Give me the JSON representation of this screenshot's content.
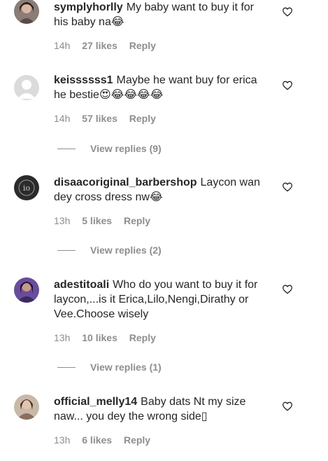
{
  "comments": [
    {
      "username": "symplyhorlly",
      "text": "My baby want to buy it for his baby na😂",
      "time": "14h",
      "likes": "27 likes",
      "reply": "Reply",
      "avatar": "photo-avatar-woman"
    },
    {
      "username": "keissssss1",
      "text": "Maybe he want buy for erica he bestie😍😂😂😂😂",
      "time": "14h",
      "likes": "57 likes",
      "reply": "Reply",
      "avatar": "default-avatar",
      "view_replies": "View replies (9)"
    },
    {
      "username": "disaacoriginal_barbershop",
      "text": "Laycon wan dey cross dress nw😂",
      "time": "13h",
      "likes": "5 likes",
      "reply": "Reply",
      "avatar": "logo-avatar-dark",
      "view_replies": "View replies (2)"
    },
    {
      "username": "adestitoali",
      "text": "Who do you want to buy it for laycon,...is it Erica,Lilo,Nengi,Dirathy or Vee.Choose wisely",
      "time": "13h",
      "likes": "10 likes",
      "reply": "Reply",
      "avatar": "photo-avatar-purple",
      "view_replies": "View replies (1)"
    },
    {
      "username": "official_melly14",
      "text": "Baby dats Nt my size naw... you dey the wrong side▯",
      "time": "13h",
      "likes": "6 likes",
      "reply": "Reply",
      "avatar": "photo-avatar-woman-2"
    }
  ],
  "colors": {
    "text": "#262626",
    "secondary": "#8e8e8e",
    "background": "#ffffff"
  },
  "icons": {
    "like": "heart-outline-icon"
  }
}
